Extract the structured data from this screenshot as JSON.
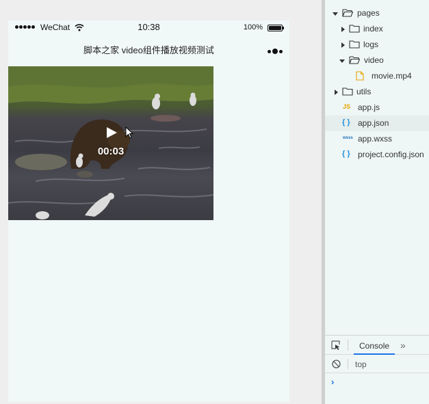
{
  "status_bar": {
    "carrier": "WeChat",
    "time": "10:38",
    "battery_percent": "100%",
    "battery_level": 1.0
  },
  "nav_bar": {
    "title": "脚本之家 video组件播放视频测试"
  },
  "video": {
    "current_time": "00:03",
    "state": "paused"
  },
  "file_tree": {
    "items": [
      {
        "label": "pages",
        "type": "folder",
        "expanded": true
      },
      {
        "label": "index",
        "type": "folder",
        "expanded": false
      },
      {
        "label": "logs",
        "type": "folder",
        "expanded": false
      },
      {
        "label": "video",
        "type": "folder",
        "expanded": true
      },
      {
        "label": "movie.mp4",
        "type": "file",
        "icon": "file-icon"
      },
      {
        "label": "utils",
        "type": "folder",
        "expanded": false
      },
      {
        "label": "app.js",
        "type": "file",
        "badge": "JS"
      },
      {
        "label": "app.json",
        "type": "file",
        "badge": "{ }",
        "selected": true
      },
      {
        "label": "app.wxss",
        "type": "file",
        "badge": "wxss"
      },
      {
        "label": "project.config.json",
        "type": "file",
        "badge": "{ }"
      }
    ]
  },
  "devtools": {
    "tab_console": "Console",
    "more_tabs": "»",
    "context": "top",
    "prompt": "›"
  },
  "colors": {
    "phone_background": "#f1f8f8",
    "tree_background": "#eef6f6",
    "accent": "#1a73e8",
    "folder_stroke": "#333333",
    "js_badge": "#e8a400",
    "json_badge": "#1f8fd8"
  }
}
